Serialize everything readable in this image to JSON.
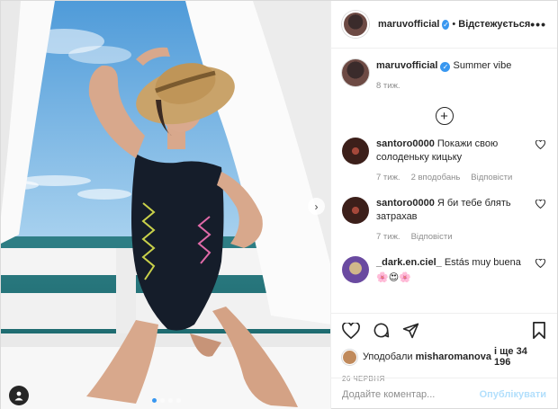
{
  "header": {
    "username": "maruvofficial",
    "separator": "•",
    "follow_label": "Відстежується",
    "more_label": "•••"
  },
  "caption": {
    "username": "maruvofficial",
    "text": "Summer vibe",
    "time": "8 тиж."
  },
  "comments": [
    {
      "username": "santoro0000",
      "text": "Покажи свою солоденьку кицьку",
      "time": "7 тиж.",
      "likes": "2 вподобань",
      "reply": "Відповісти"
    },
    {
      "username": "santoro0000",
      "text": "Я би тебе блять затрахав",
      "time": "7 тиж.",
      "reply": "Відповісти"
    },
    {
      "username": "_dark.en.ciel_",
      "text": "Estás muy buena",
      "emoji": "🌸😍🌸"
    }
  ],
  "likes": {
    "prefix": "Уподобали",
    "user": "misharomanova",
    "suffix": "і ще 34 196"
  },
  "date": "26 ЧЕРВНЯ",
  "add_comment": {
    "placeholder": "Додайте коментар...",
    "post_label": "Опублікувати"
  },
  "carousel": {
    "slides": 4,
    "active": 0
  },
  "icons": {
    "like": "heart-icon",
    "comment": "comment-icon",
    "share": "share-icon",
    "save": "bookmark-icon",
    "next": "chevron-right-icon",
    "tag": "user-tag-icon"
  },
  "colors": {
    "accent": "#3897f0",
    "muted": "#8e8e8e",
    "post_disabled": "#b2dffc"
  }
}
